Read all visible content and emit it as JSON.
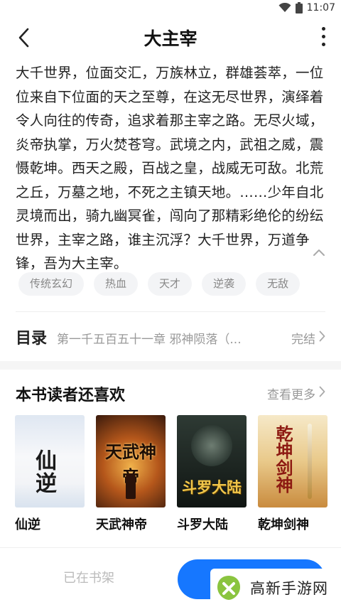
{
  "status_bar": {
    "time": "11:07",
    "wifi_icon": "wifi-icon",
    "battery_icon": "battery-icon"
  },
  "nav": {
    "title": "大主宰",
    "back_icon": "back-arrow-icon",
    "more_icon": "more-vertical-icon"
  },
  "description": "大千世界，位面交汇，万族林立，群雄荟萃，一位位来自下位面的天之至尊，在这无尽世界，演绎着令人向往的传奇，追求着那主宰之路。无尽火域，炎帝执掌，万火焚苍穹。武境之内，武祖之威，震慑乾坤。西天之殿，百战之皇，战威无可敌。北荒之丘，万墓之地，不死之主镇天地。……少年自北灵境而出，骑九幽冥雀，闯向了那精彩绝伦的纷纭世界，主宰之路，谁主沉浮？大千世界，万道争锋，吾为大主宰。",
  "tags": [
    "传统玄幻",
    "热血",
    "天才",
    "逆袭",
    "无敌"
  ],
  "toc": {
    "label": "目录",
    "latest_chapter": "第一千五百五十一章 邪神陨落（...",
    "status": "完结"
  },
  "recommendations": {
    "title": "本书读者还喜欢",
    "see_more": "查看更多",
    "books": [
      {
        "title": "仙逆",
        "cover_text": "仙逆"
      },
      {
        "title": "天武神帝",
        "cover_text": "天武神帝"
      },
      {
        "title": "斗罗大陆",
        "cover_text": "斗罗大陆"
      },
      {
        "title": "乾坤剑神",
        "cover_text": "乾坤剑神"
      }
    ]
  },
  "bottom_bar": {
    "shelf_label": "已在书架"
  },
  "watermark": {
    "text": "高新手游网"
  },
  "colors": {
    "accent": "#1677ff",
    "tag_bg": "#f3f4f6",
    "muted_text": "#999999"
  }
}
